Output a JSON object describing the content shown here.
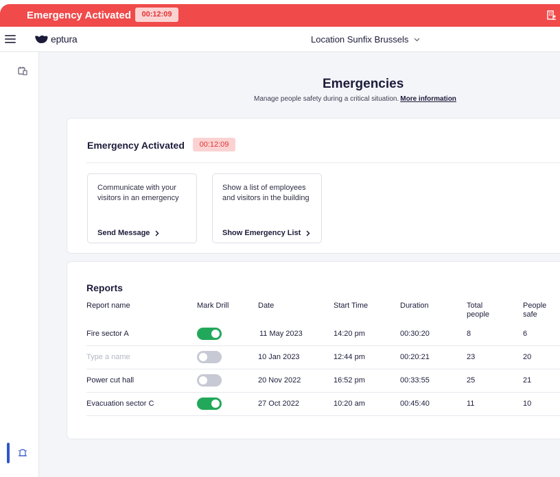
{
  "banner": {
    "title": "Emergency Activated",
    "timer": "00:12:09",
    "icon": "building-people-icon",
    "color": "#f04a4a"
  },
  "header": {
    "logo_text": "eptura",
    "location": "Location Sunfix Brussels"
  },
  "sidebar": {
    "items": [
      {
        "icon": "calendar-building-icon",
        "active": false
      },
      {
        "icon": "emergency-alarm-icon",
        "active": true
      }
    ]
  },
  "page": {
    "title": "Emergencies",
    "subtitle": "Manage people safety during a critical situation.",
    "more_info": "More information"
  },
  "emergency": {
    "title": "Emergency Activated",
    "timer": "00:12:09",
    "actions": [
      {
        "description": "Communicate with your visitors in an emergency",
        "link": "Send Message"
      },
      {
        "description": "Show a list of employees and visitors in the building",
        "link": "Show Emergency List"
      }
    ]
  },
  "reports": {
    "title": "Reports",
    "columns": [
      "Report name",
      "Mark Drill",
      "Date",
      "Start Time",
      "Duration",
      "Total people",
      "People safe"
    ],
    "rows": [
      {
        "name": "Fire sector A",
        "drill": true,
        "date": "11 May 2023",
        "start": "14:20 pm",
        "duration": "00:30:20",
        "total": "8",
        "safe": "6"
      },
      {
        "name": "",
        "name_placeholder": "Type a name",
        "drill": false,
        "date": "10 Jan 2023",
        "start": "12:44 pm",
        "duration": "00:20:21",
        "total": "23",
        "safe": "20"
      },
      {
        "name": "Power cut hall",
        "drill": false,
        "date": "20 Nov 2022",
        "start": "16:52 pm",
        "duration": "00:33:55",
        "total": "25",
        "safe": "21"
      },
      {
        "name": "Evacuation sector C",
        "drill": true,
        "date": "27 Oct 2022",
        "start": "10:20 am",
        "duration": "00:45:40",
        "total": "11",
        "safe": "10"
      }
    ]
  },
  "colors": {
    "accent_green": "#22a85a",
    "toggle_off": "#c7c9d4",
    "brand_navy": "#1b1b3a",
    "active_blue": "#2f56c8"
  }
}
